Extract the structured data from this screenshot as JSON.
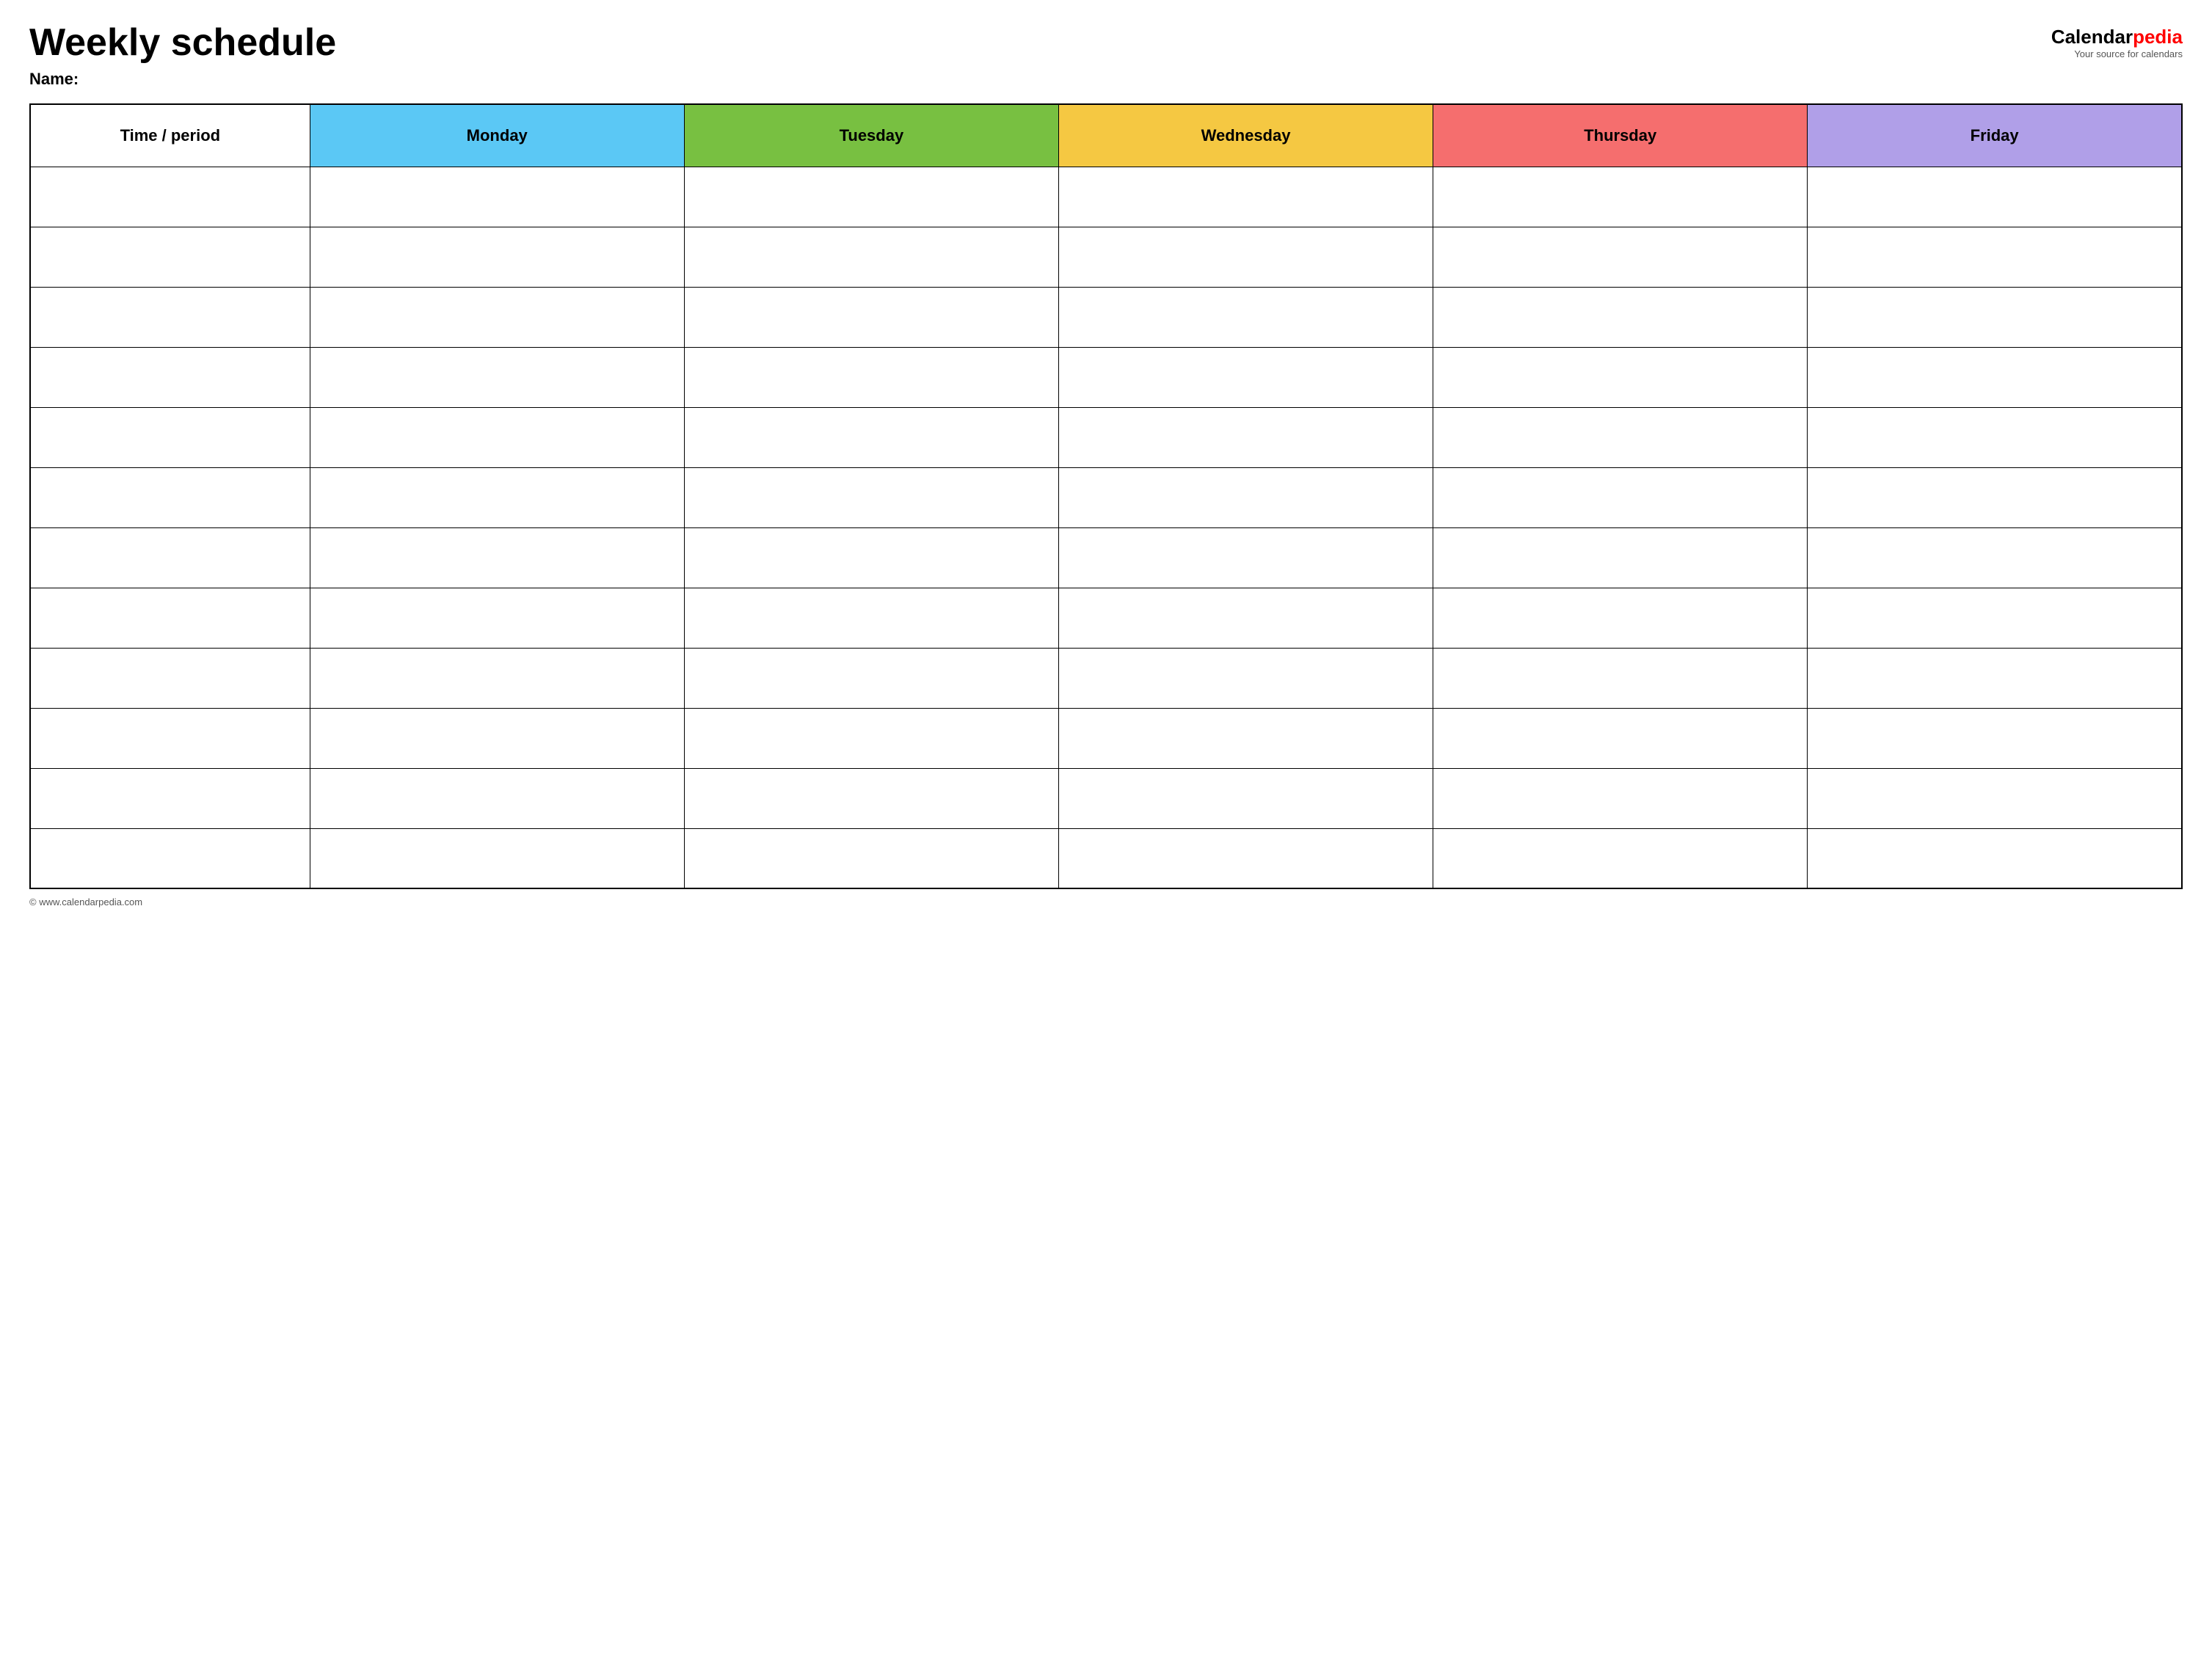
{
  "header": {
    "title": "Weekly schedule",
    "name_label": "Name:",
    "logo": {
      "calendar_part": "Calendar",
      "pedia_part": "pedia",
      "tagline": "Your source for calendars"
    }
  },
  "table": {
    "columns": [
      {
        "key": "time",
        "label": "Time / period",
        "color_class": "col-time"
      },
      {
        "key": "monday",
        "label": "Monday",
        "color_class": "col-monday"
      },
      {
        "key": "tuesday",
        "label": "Tuesday",
        "color_class": "col-tuesday"
      },
      {
        "key": "wednesday",
        "label": "Wednesday",
        "color_class": "col-wednesday"
      },
      {
        "key": "thursday",
        "label": "Thursday",
        "color_class": "col-thursday"
      },
      {
        "key": "friday",
        "label": "Friday",
        "color_class": "col-friday"
      }
    ],
    "rows": 12
  },
  "footer": {
    "text": "© www.calendarpedia.com"
  }
}
